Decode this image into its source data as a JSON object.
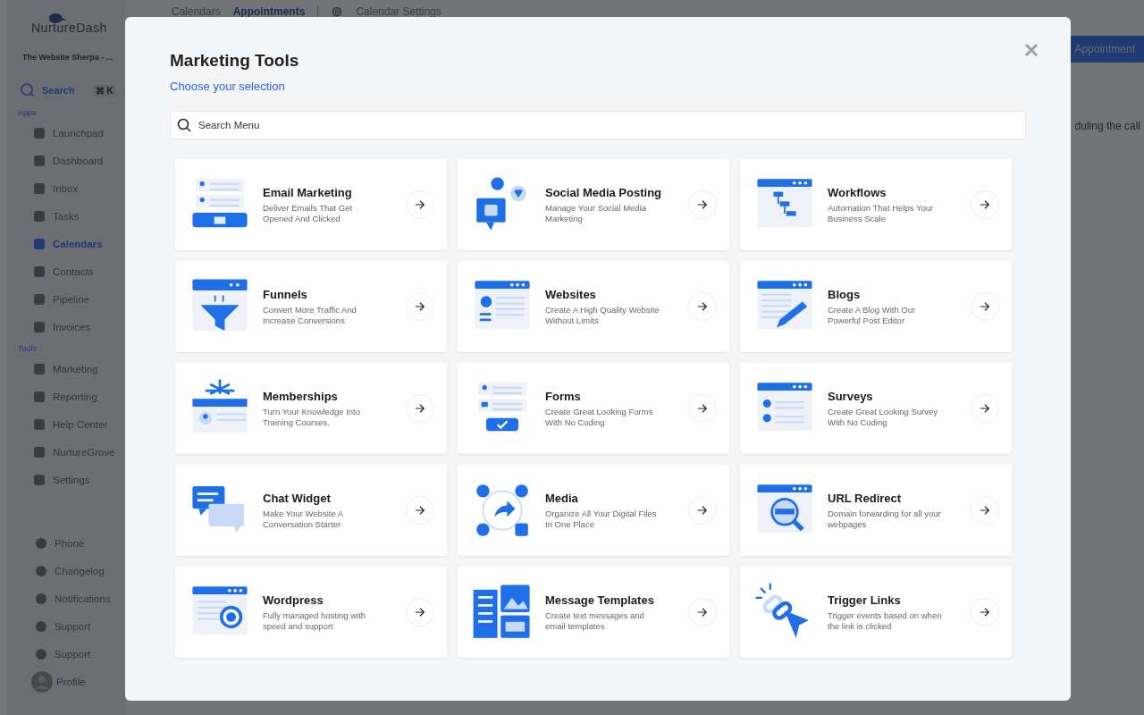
{
  "app": {
    "logo": "NurtureDash",
    "account": "The Website Sherpa - ...",
    "search": {
      "label": "Search",
      "shortcut": "⌘ K"
    },
    "sections": [
      {
        "title": "Apps",
        "items": [
          {
            "label": "Launchpad",
            "selected": false
          },
          {
            "label": "Dashboard",
            "selected": false
          },
          {
            "label": "Inbox",
            "selected": false
          },
          {
            "label": "Tasks",
            "selected": false
          },
          {
            "label": "Calendars",
            "selected": true
          },
          {
            "label": "Contacts",
            "selected": false
          },
          {
            "label": "Pipeline",
            "selected": false
          },
          {
            "label": "Invoices",
            "selected": false
          }
        ]
      },
      {
        "title": "Tools",
        "items": [
          {
            "label": "Marketing",
            "selected": false
          },
          {
            "label": "Reporting",
            "selected": false
          },
          {
            "label": "Help Center",
            "selected": false
          },
          {
            "label": "NurtureGrove",
            "selected": false
          },
          {
            "label": "Settings",
            "selected": false
          }
        ]
      }
    ],
    "bottom_items": [
      "Phone",
      "Changelog",
      "Notifications",
      "Support",
      "Support"
    ],
    "profile": "Profile",
    "tabs": [
      {
        "label": "Calendars",
        "selected": false
      },
      {
        "label": "Appointments",
        "selected": true
      }
    ],
    "settings_tab": "Calendar Settings",
    "action_button": "Appointment",
    "body_text": "duling the call"
  },
  "modal": {
    "title": "Marketing Tools",
    "subtitle": "Choose your selection",
    "search": {
      "placeholder": "Search Menu"
    },
    "tools": [
      {
        "title": "Email Marketing",
        "description": "Deliver Emails That Get Opened And Clicked"
      },
      {
        "title": "Social Media Posting",
        "description": "Manage Your Social Media Marketing"
      },
      {
        "title": "Workflows",
        "description": "Automation That Helps Your Business Scale"
      },
      {
        "title": "Funnels",
        "description": "Convert More Traffic And Increase Conversions"
      },
      {
        "title": "Websites",
        "description": "Create A High Quality Website Without Limits"
      },
      {
        "title": "Blogs",
        "description": "Create A Blog With Our Powerful Post Editor"
      },
      {
        "title": "Memberships",
        "description": "Turn Your Knowledge Into Training Courses."
      },
      {
        "title": "Forms",
        "description": "Create Great Looking Forms With No Coding"
      },
      {
        "title": "Surveys",
        "description": "Create Great Looking Survey With No Coding"
      },
      {
        "title": "Chat Widget",
        "description": "Make Your Website A Conversation Starter"
      },
      {
        "title": "Media",
        "description": "Organize All Your Digital Files In One Place"
      },
      {
        "title": "URL Redirect",
        "description": "Domain forwarding for all your webpages"
      },
      {
        "title": "Wordpress",
        "description": "Fully managed hosting with speed and support"
      },
      {
        "title": "Message Templates",
        "description": "Create text messages and email templates"
      },
      {
        "title": "Trigger Links",
        "description": "Trigger events based on when the link is clicked"
      }
    ]
  }
}
